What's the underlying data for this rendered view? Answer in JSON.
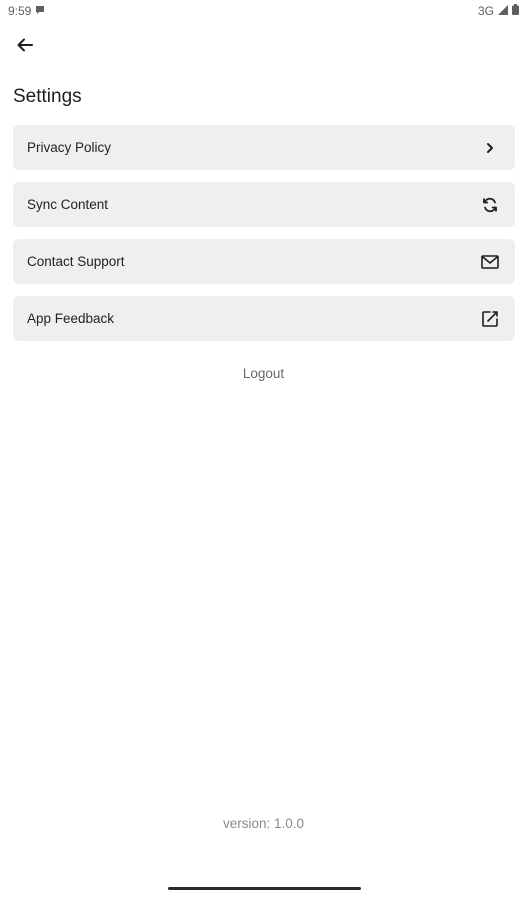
{
  "status_bar": {
    "time": "9:59",
    "network": "3G",
    "icons": [
      "chat-bubble-icon",
      "signal-icon",
      "battery-icon"
    ]
  },
  "header": {
    "back_icon": "arrow-left-icon",
    "title": "Settings"
  },
  "settings": {
    "items": [
      {
        "label": "Privacy Policy",
        "icon": "chevron-right-icon"
      },
      {
        "label": "Sync Content",
        "icon": "sync-icon"
      },
      {
        "label": "Contact Support",
        "icon": "mail-icon"
      },
      {
        "label": "App Feedback",
        "icon": "external-edit-icon"
      }
    ]
  },
  "logout_label": "Logout",
  "version": "version: 1.0.0",
  "colors": {
    "item_background": "#eeeff0",
    "text_primary": "#1f1f1f",
    "text_muted": "#8a8a8a"
  }
}
